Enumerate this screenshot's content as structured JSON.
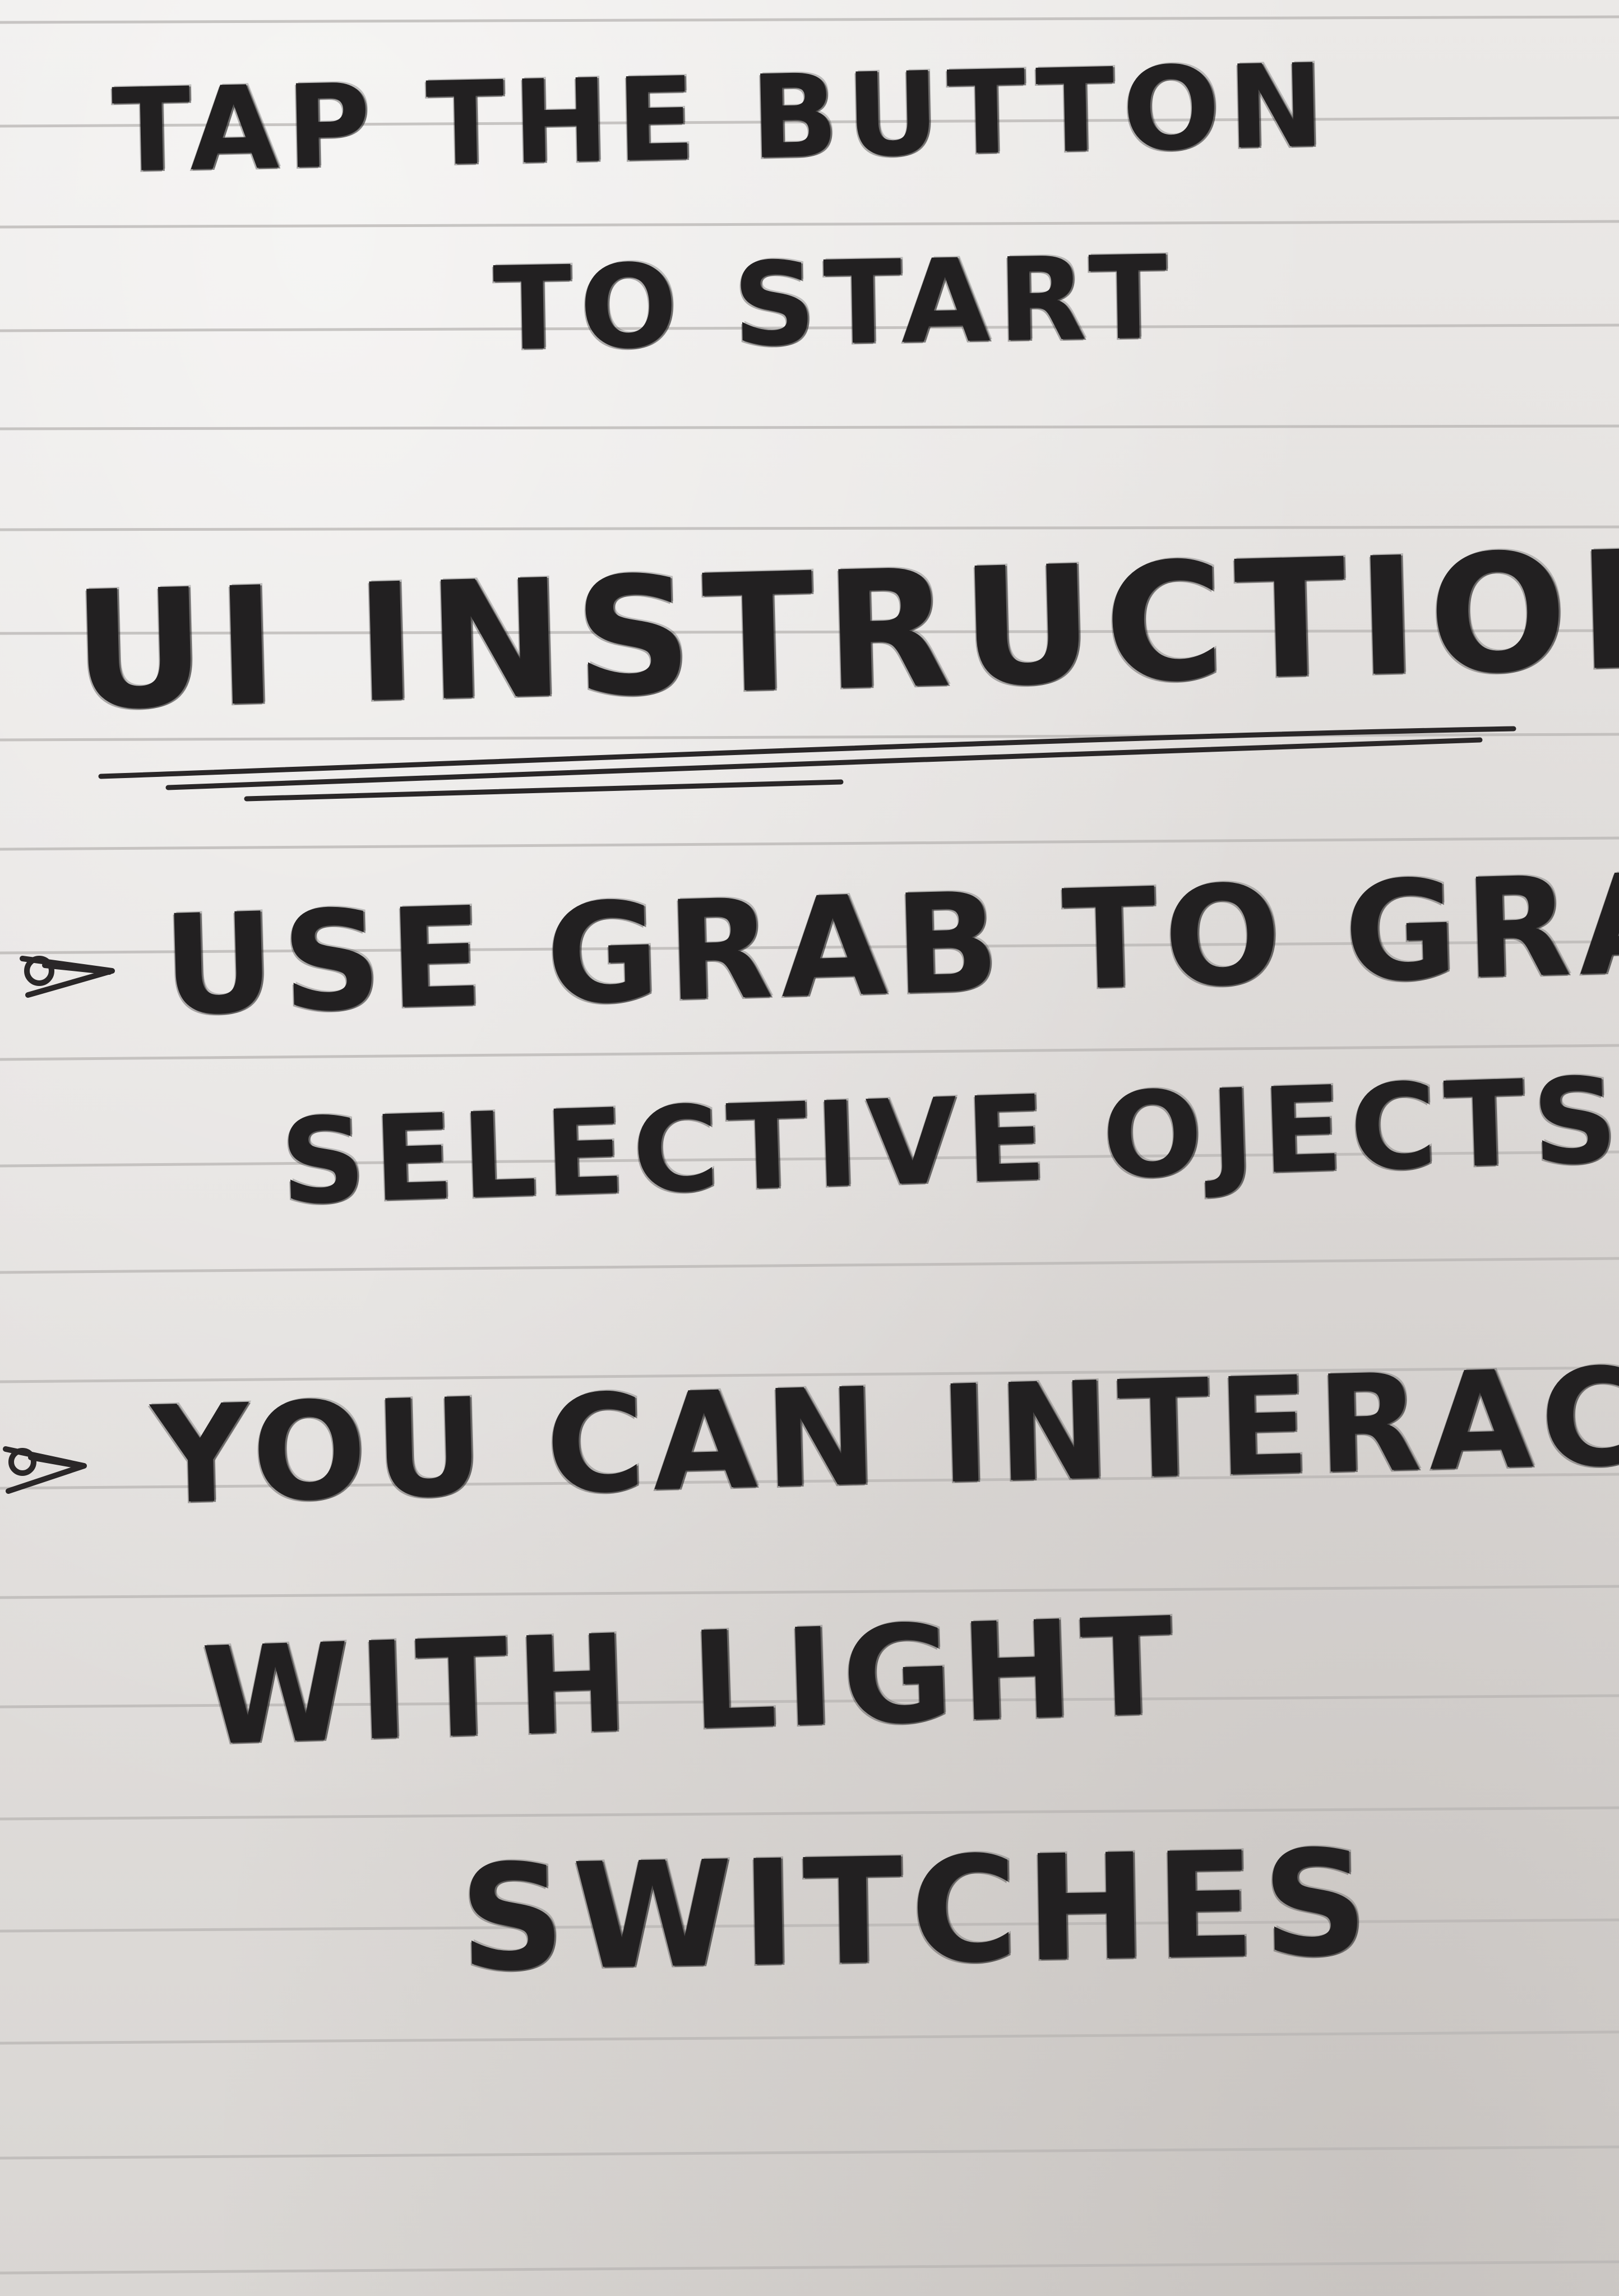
{
  "note": {
    "header_lines": [
      "TAP THE BUTTON",
      "TO START"
    ],
    "title": "UI INSTRUCTION",
    "bullets": [
      {
        "lines": [
          "USE GRAB TO GRAB",
          "SELECTIVE OJECTS."
        ]
      },
      {
        "lines": [
          "YOU CAN INTERACT",
          "WITH LIGHT",
          "SWITCHES"
        ]
      }
    ]
  },
  "colors": {
    "paper": "#e6e3e0",
    "ink": "#222021",
    "rule": "#b9b6b4"
  },
  "icons": {
    "bullet": "hand-drawn-arrow-icon"
  }
}
